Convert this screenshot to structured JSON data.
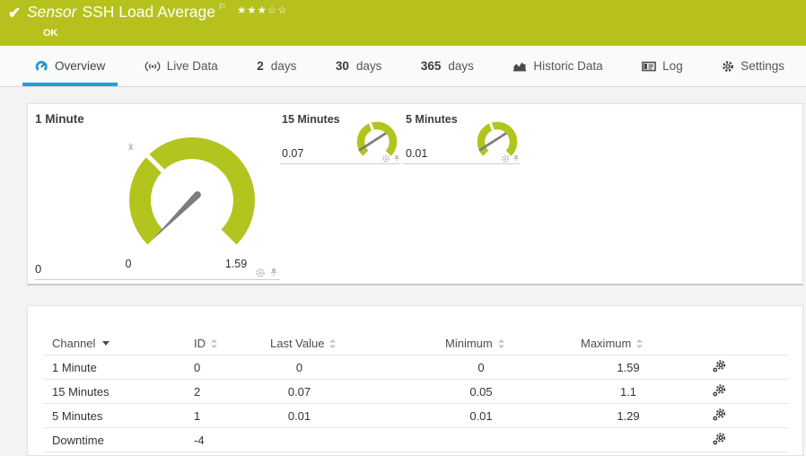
{
  "header": {
    "check_icon": "✔",
    "title_prefix": "Sensor",
    "title": "SSH Load Average",
    "flag_icon": "⚐",
    "stars_display": "★★★☆☆",
    "stars_filled": 3,
    "stars_total": 5,
    "status": "OK"
  },
  "tabs": [
    {
      "label": "Overview",
      "icon": "gauge-icon",
      "active": true
    },
    {
      "label": "Live Data",
      "icon": "broadcast-icon"
    },
    {
      "value": "2",
      "label": "days"
    },
    {
      "value": "30",
      "label": "days"
    },
    {
      "value": "365",
      "label": "days"
    },
    {
      "label": "Historic Data",
      "icon": "area-chart-icon"
    },
    {
      "label": "Log",
      "icon": "log-icon"
    },
    {
      "label": "Settings",
      "icon": "gear-icon"
    }
  ],
  "gauges": {
    "main": {
      "label": "1 Minute",
      "current_value": "0",
      "scale_min": "0",
      "scale_max": "1.59",
      "avg_marker": "x̄"
    },
    "mini": [
      {
        "label": "15 Minutes",
        "current_value": "0.07"
      },
      {
        "label": "5 Minutes",
        "current_value": "0.01"
      }
    ]
  },
  "table": {
    "headers": {
      "channel": "Channel",
      "id": "ID",
      "last_value": "Last Value",
      "minimum": "Minimum",
      "maximum": "Maximum"
    },
    "rows": [
      {
        "channel": "1 Minute",
        "id": "0",
        "last_value": "0",
        "minimum": "0",
        "maximum": "1.59"
      },
      {
        "channel": "15 Minutes",
        "id": "2",
        "last_value": "0.07",
        "minimum": "0.05",
        "maximum": "1.1"
      },
      {
        "channel": "5 Minutes",
        "id": "1",
        "last_value": "0.01",
        "minimum": "0.01",
        "maximum": "1.29"
      },
      {
        "channel": "Downtime",
        "id": "-4",
        "last_value": "",
        "minimum": "",
        "maximum": ""
      }
    ]
  },
  "colors": {
    "header_bg": "#b7c11d",
    "gauge_green": "#b1c51e",
    "accent_blue": "#219fd6",
    "needle_gray": "#7d7d7d",
    "page_bg": "#f3f3f3"
  }
}
